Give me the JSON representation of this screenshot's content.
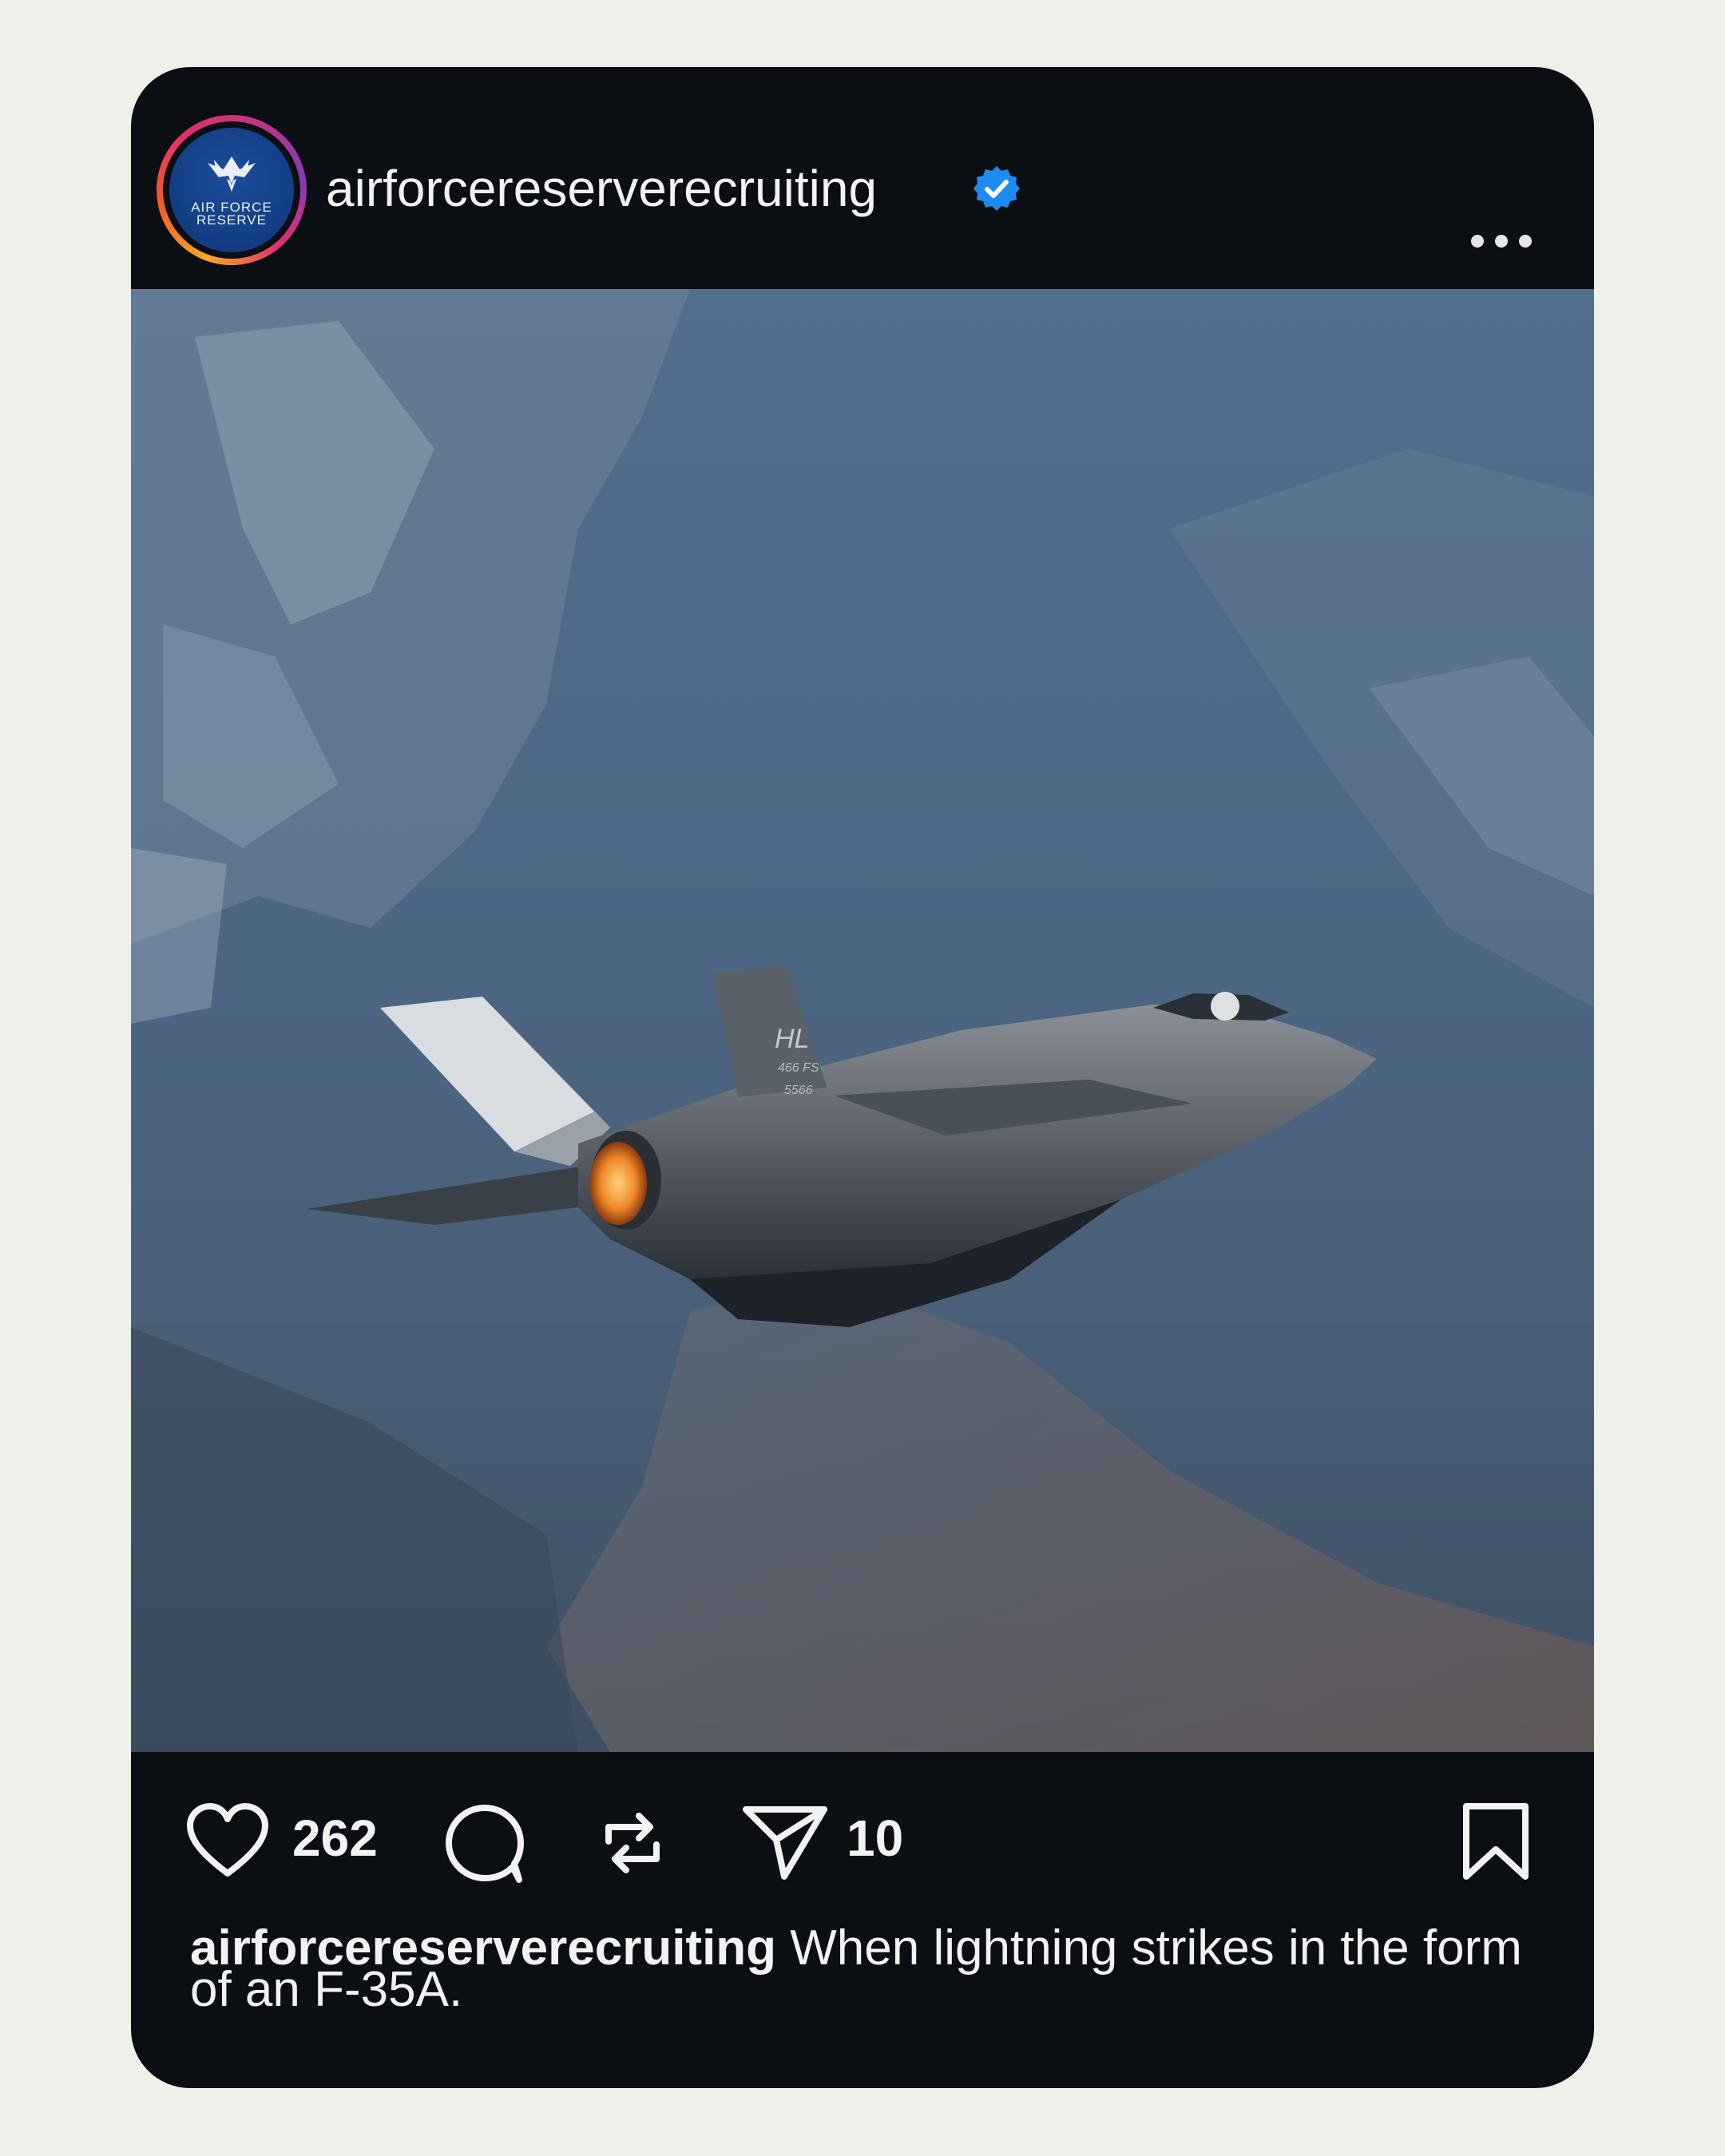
{
  "post": {
    "username": "airforcereserverecruiting",
    "verified": true,
    "avatar": {
      "logo_line1": "AIR FORCE",
      "logo_line2": "RESERVE",
      "icon": "air-force-wings-icon"
    },
    "menu_icon": "more-horizontal-icon",
    "image": {
      "subject": "F-35A fighter jet over snowy mountain slope",
      "tail_code": "HL",
      "tail_unit": "466 FS",
      "tail_serial": "5566"
    },
    "actions": {
      "like_icon": "heart-icon",
      "like_count": "262",
      "comment_icon": "comment-icon",
      "repost_icon": "repost-icon",
      "share_icon": "send-icon",
      "share_count": "10",
      "save_icon": "bookmark-icon"
    },
    "caption": {
      "username": "airforcereserverecruiting",
      "text": " When lightning strikes in the form of an F-35A."
    }
  },
  "colors": {
    "page_background": "#f1efea",
    "card_background": "#0b0e13",
    "verified_badge": "#1d8cf0",
    "text": "#f2f2f2"
  }
}
